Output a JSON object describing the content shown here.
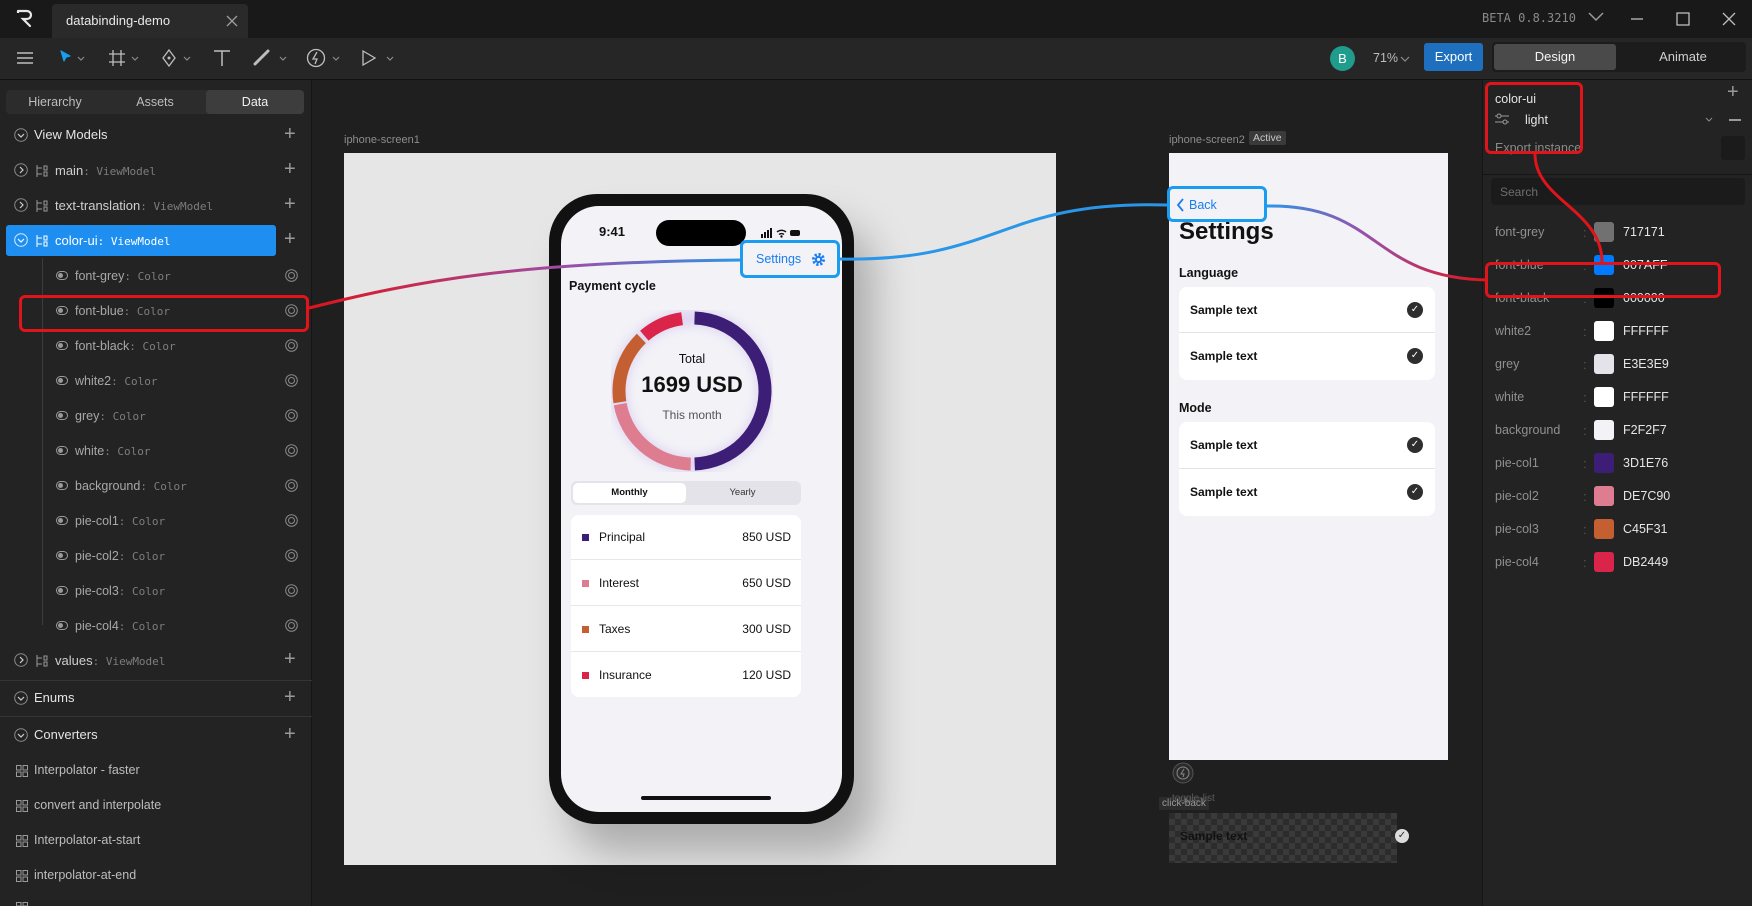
{
  "app": {
    "tab_title": "databinding-demo",
    "version": "BETA 0.8.3210"
  },
  "toolbar": {
    "avatar_initial": "B",
    "zoom": "71%",
    "export_label": "Export",
    "mode_design": "Design",
    "mode_animate": "Animate"
  },
  "left_panel": {
    "tabs": [
      "Hierarchy",
      "Assets",
      "Data"
    ],
    "view_models_label": "View Models",
    "vms": [
      {
        "name": "main",
        "type": ": ViewModel"
      },
      {
        "name": "text-translation",
        "type": ": ViewModel"
      },
      {
        "name": "color-ui",
        "type": ": ViewModel"
      }
    ],
    "props": [
      {
        "name": "font-grey",
        "type": ": Color"
      },
      {
        "name": "font-blue",
        "type": ": Color"
      },
      {
        "name": "font-black",
        "type": ": Color"
      },
      {
        "name": "white2",
        "type": ": Color"
      },
      {
        "name": "grey",
        "type": ": Color"
      },
      {
        "name": "white",
        "type": ": Color"
      },
      {
        "name": "background",
        "type": ": Color"
      },
      {
        "name": "pie-col1",
        "type": ": Color"
      },
      {
        "name": "pie-col2",
        "type": ": Color"
      },
      {
        "name": "pie-col3",
        "type": ": Color"
      },
      {
        "name": "pie-col4",
        "type": ": Color"
      }
    ],
    "values_vm": {
      "name": "values",
      "type": ": ViewModel"
    },
    "enums_label": "Enums",
    "converters_label": "Converters",
    "converters": [
      "Interpolator - faster",
      "convert and interpolate",
      "Interpolator-at-start",
      "interpolator-at-end"
    ]
  },
  "canvas": {
    "screen1_label": "iphone-screen1",
    "screen2_label": "iphone-screen2",
    "active_badge": "Active",
    "phone": {
      "time": "9:41",
      "settings_button": "Settings",
      "payment_cycle": "Payment cycle",
      "total_label": "Total",
      "total_value": "1699 USD",
      "period": "This month",
      "toggle_monthly": "Monthly",
      "toggle_yearly": "Yearly",
      "rows": [
        {
          "label": "Principal",
          "value": "850 USD",
          "color": "#3D1E76"
        },
        {
          "label": "Interest",
          "value": "650 USD",
          "color": "#DE7C90"
        },
        {
          "label": "Taxes",
          "value": "300 USD",
          "color": "#C45F31"
        },
        {
          "label": "Insurance",
          "value": "120 USD",
          "color": "#DB2449"
        }
      ]
    },
    "settings": {
      "back": "Back",
      "title": "Settings",
      "language_label": "Language",
      "mode_label": "Mode",
      "sample": "Sample text"
    },
    "toggle_list_label": "toggle-list",
    "click_back_label": "click-back",
    "sample_text": "Sample text"
  },
  "right_panel": {
    "vm_name": "color-ui",
    "instance": "light",
    "export_instance": "Export instance",
    "search_placeholder": "Search",
    "colors": [
      {
        "name": "font-grey",
        "hex": "717171",
        "color": "#717171"
      },
      {
        "name": "font-blue",
        "hex": "007AFF",
        "color": "#007AFF"
      },
      {
        "name": "font-black",
        "hex": "000000",
        "color": "#000000"
      },
      {
        "name": "white2",
        "hex": "FFFFFF",
        "color": "#FFFFFF"
      },
      {
        "name": "grey",
        "hex": "E3E3E9",
        "color": "#E3E3E9"
      },
      {
        "name": "white",
        "hex": "FFFFFF",
        "color": "#FFFFFF"
      },
      {
        "name": "background",
        "hex": "F2F2F7",
        "color": "#F2F2F7"
      },
      {
        "name": "pie-col1",
        "hex": "3D1E76",
        "color": "#3D1E76"
      },
      {
        "name": "pie-col2",
        "hex": "DE7C90",
        "color": "#DE7C90"
      },
      {
        "name": "pie-col3",
        "hex": "C45F31",
        "color": "#C45F31"
      },
      {
        "name": "pie-col4",
        "hex": "DB2449",
        "color": "#DB2449"
      }
    ]
  },
  "colors": {
    "accent": "#1a9cf0",
    "selection": "#1e8ff0",
    "highlight": "#e0141b",
    "export_btn": "#1f6fbf"
  }
}
